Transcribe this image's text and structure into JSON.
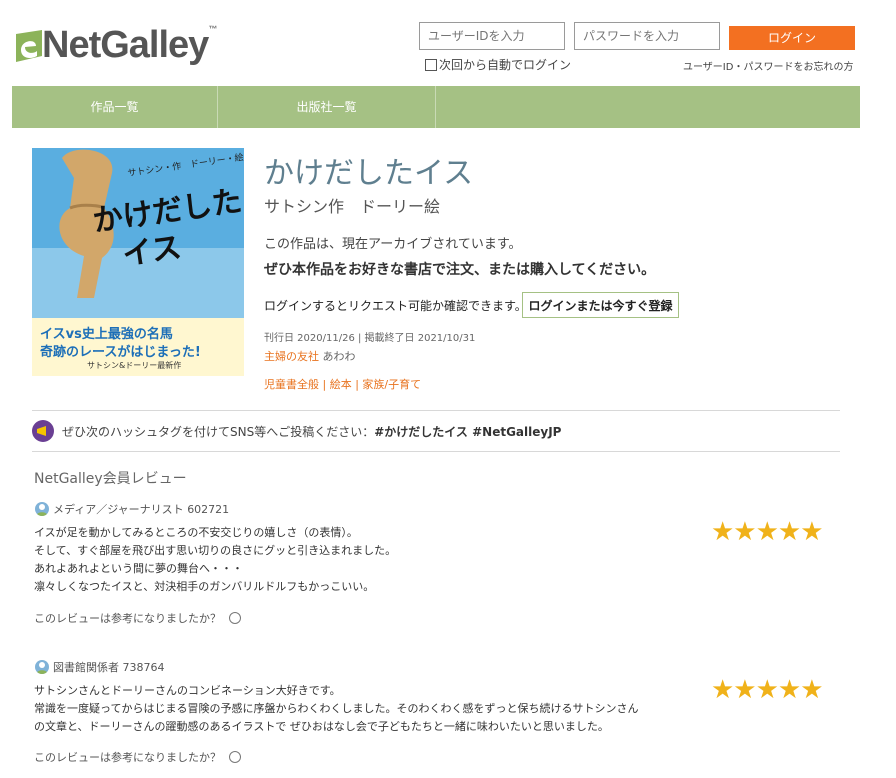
{
  "header": {
    "logo_text": "NetGalley",
    "logo_tm": "™",
    "user_id_placeholder": "ユーザーIDを入力",
    "password_placeholder": "パスワードを入力",
    "login_label": "ログイン",
    "remember_label": "次回から自動でログイン",
    "forgot_label": "ユーザーID・パスワードをお忘れの方"
  },
  "nav": {
    "items": [
      "作品一覧",
      "出版社一覧"
    ]
  },
  "book": {
    "cover_author": "サトシン・作　ドーリー・絵",
    "cover_title_1": "かけだした",
    "cover_title_2": "イス",
    "cover_tagline_1": "イスvs史上最強の名馬",
    "cover_tagline_2": "奇跡のレースがはじまった!",
    "cover_tagline_3": "サトシン&ドーリー最新作",
    "title": "かけだしたイス",
    "author": "サトシン作　ドーリー絵",
    "archived": "この作品は、現在アーカイブされています。",
    "buy_message": "ぜひ本作品をお好きな書店で注文、または購入してください。",
    "login_note": "ログインするとリクエスト可能か確認できます。",
    "register_button": "ログインまたは今すぐ登録",
    "dates": "刊行日 2020/11/26 | 掲載終了日 2021/10/31",
    "publisher": "主婦の友社",
    "imprint": "あわわ",
    "genres": "児童書全般 | 絵本 | 家族/子育て"
  },
  "hashtag": {
    "text": "ぜひ次のハッシュタグを付けてSNS等へご投稿ください：",
    "tags": "#かけだしたイス #NetGalleyJP"
  },
  "reviews": {
    "heading": "NetGalley会員レビュー",
    "helpful_label": "このレビューは参考になりましたか？",
    "star_color": "#f0b21a",
    "items": [
      {
        "reviewer": "メディア／ジャーナリスト",
        "id": "602721",
        "rating": 5,
        "lines": [
          "イスが足を動かしてみるところの不安交じりの嬉しさ（の表情）。",
          "そして、すぐ部屋を飛び出す思い切りの良さにグッと引き込まれました。",
          "あれよあれよという間に夢の舞台へ・・・",
          "凛々しくなつたイスと、対決相手のガンバリルドルフもかっこいい。"
        ]
      },
      {
        "reviewer": "図書館関係者",
        "id": "738764",
        "rating": 5,
        "lines": [
          "サトシンさんとドーリーさんのコンビネーション大好きです。",
          "常識を一度疑ってからはじまる冒険の予感に序盤からわくわくしました。そのわくわく感をずっと保ち続けるサトシンさん",
          "の文章と、ドーリーさんの躍動感のあるイラストで ぜひおはなし会で子どもたちと一緒に味わいたいと思いました。"
        ]
      }
    ]
  },
  "colors": {
    "accent": "#f37021",
    "nav": "#a5c184",
    "title": "#5f7f8f"
  }
}
